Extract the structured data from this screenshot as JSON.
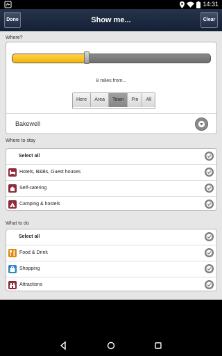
{
  "status_bar": {
    "time": "14:31"
  },
  "title_bar": {
    "done_label": "Done",
    "title": "Show me...",
    "clear_label": "Clear"
  },
  "where": {
    "label": "Where?",
    "distance_fraction": 0.375,
    "distance_text": "8 miles from...",
    "modes": [
      "Here",
      "Area",
      "Town",
      "Pin",
      "All"
    ],
    "selected_mode": "Town",
    "location": "Bakewell"
  },
  "where_to_stay": {
    "label": "Where to stay",
    "items": [
      {
        "label": "Select all",
        "icon": "none",
        "checked": true
      },
      {
        "label": "Hotels, B&Bs, Guest houses",
        "icon": "bed-icon",
        "icon_color": "#8e2a3a",
        "checked": true
      },
      {
        "label": "Self-catering",
        "icon": "house-icon",
        "icon_color": "#8e2a3a",
        "checked": true
      },
      {
        "label": "Camping & hostels",
        "icon": "tent-icon",
        "icon_color": "#8e2a3a",
        "checked": true
      }
    ]
  },
  "what_to_do": {
    "label": "What to do",
    "items": [
      {
        "label": "Select all",
        "icon": "none",
        "checked": true
      },
      {
        "label": "Food & Drink",
        "icon": "cutlery-icon",
        "icon_color": "#e08a16",
        "checked": true
      },
      {
        "label": "Shopping",
        "icon": "shopping-bag-icon",
        "icon_color": "#2f86c6",
        "checked": true
      },
      {
        "label": "Attractions",
        "icon": "attractions-icon",
        "icon_color": "#8e2a3a",
        "checked": true
      }
    ]
  },
  "colors": {
    "accent": "#f1b400",
    "title_bar": "#1b2740",
    "check": "#8d8d8d"
  }
}
